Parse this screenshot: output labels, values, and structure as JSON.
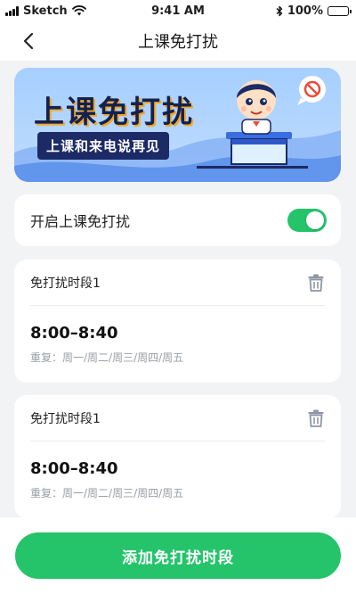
{
  "status_bar": {
    "carrier": "Sketch",
    "time": "9:41 AM",
    "battery": "100%"
  },
  "nav": {
    "title": "上课免打扰",
    "back_icon": "chevron-left-icon"
  },
  "banner": {
    "title": "上课免打扰",
    "subtitle": "上课和来电说再见"
  },
  "toggle": {
    "label": "开启上课免打扰",
    "on": true
  },
  "periods": [
    {
      "name": "免打扰时段1",
      "time": "8:00–8:40",
      "repeat": "重复：周一/周二/周三/周四/周五"
    },
    {
      "name": "免打扰时段1",
      "time": "8:00–8:40",
      "repeat": "重复：周一/周二/周三/周四/周五"
    }
  ],
  "footer": {
    "add_label": "添加免打扰时段"
  },
  "colors": {
    "accent": "#25c46b",
    "banner_bg": "#a6cfff",
    "banner_title": "#13214f",
    "banner_sub_bg": "#1c2a66",
    "page_bg": "#f2f3f5"
  }
}
